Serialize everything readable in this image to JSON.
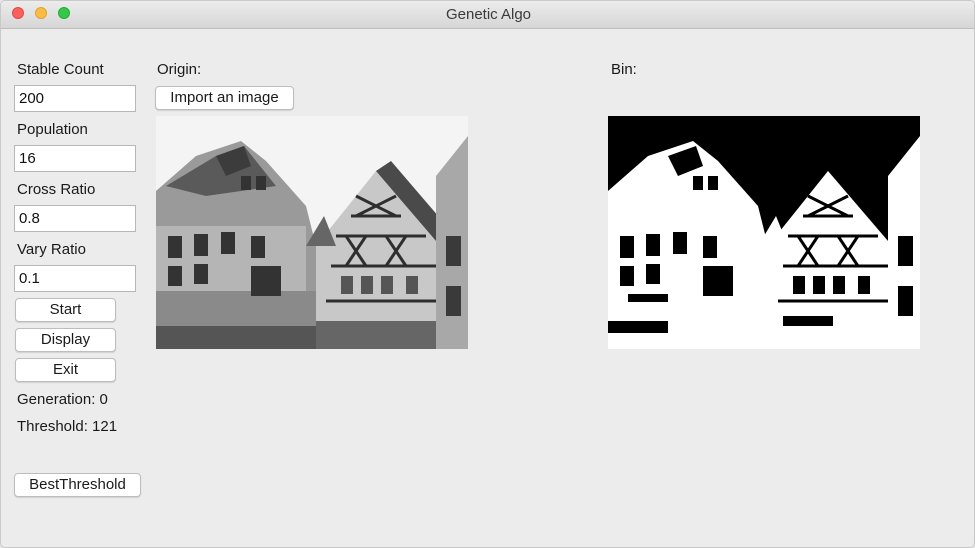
{
  "window": {
    "title": "Genetic Algo"
  },
  "params": {
    "stable_count_label": "Stable Count",
    "stable_count_value": "200",
    "population_label": "Population",
    "population_value": "16",
    "cross_ratio_label": "Cross Ratio",
    "cross_ratio_value": "0.8",
    "vary_ratio_label": "Vary Ratio",
    "vary_ratio_value": "0.1"
  },
  "buttons": {
    "start": "Start",
    "display": "Display",
    "exit": "Exit",
    "best_threshold": "BestThreshold",
    "import_image": "Import an image"
  },
  "status": {
    "generation": "Generation: 0",
    "threshold": "Threshold: 121"
  },
  "panels": {
    "origin_label": "Origin:",
    "bin_label": "Bin:"
  }
}
